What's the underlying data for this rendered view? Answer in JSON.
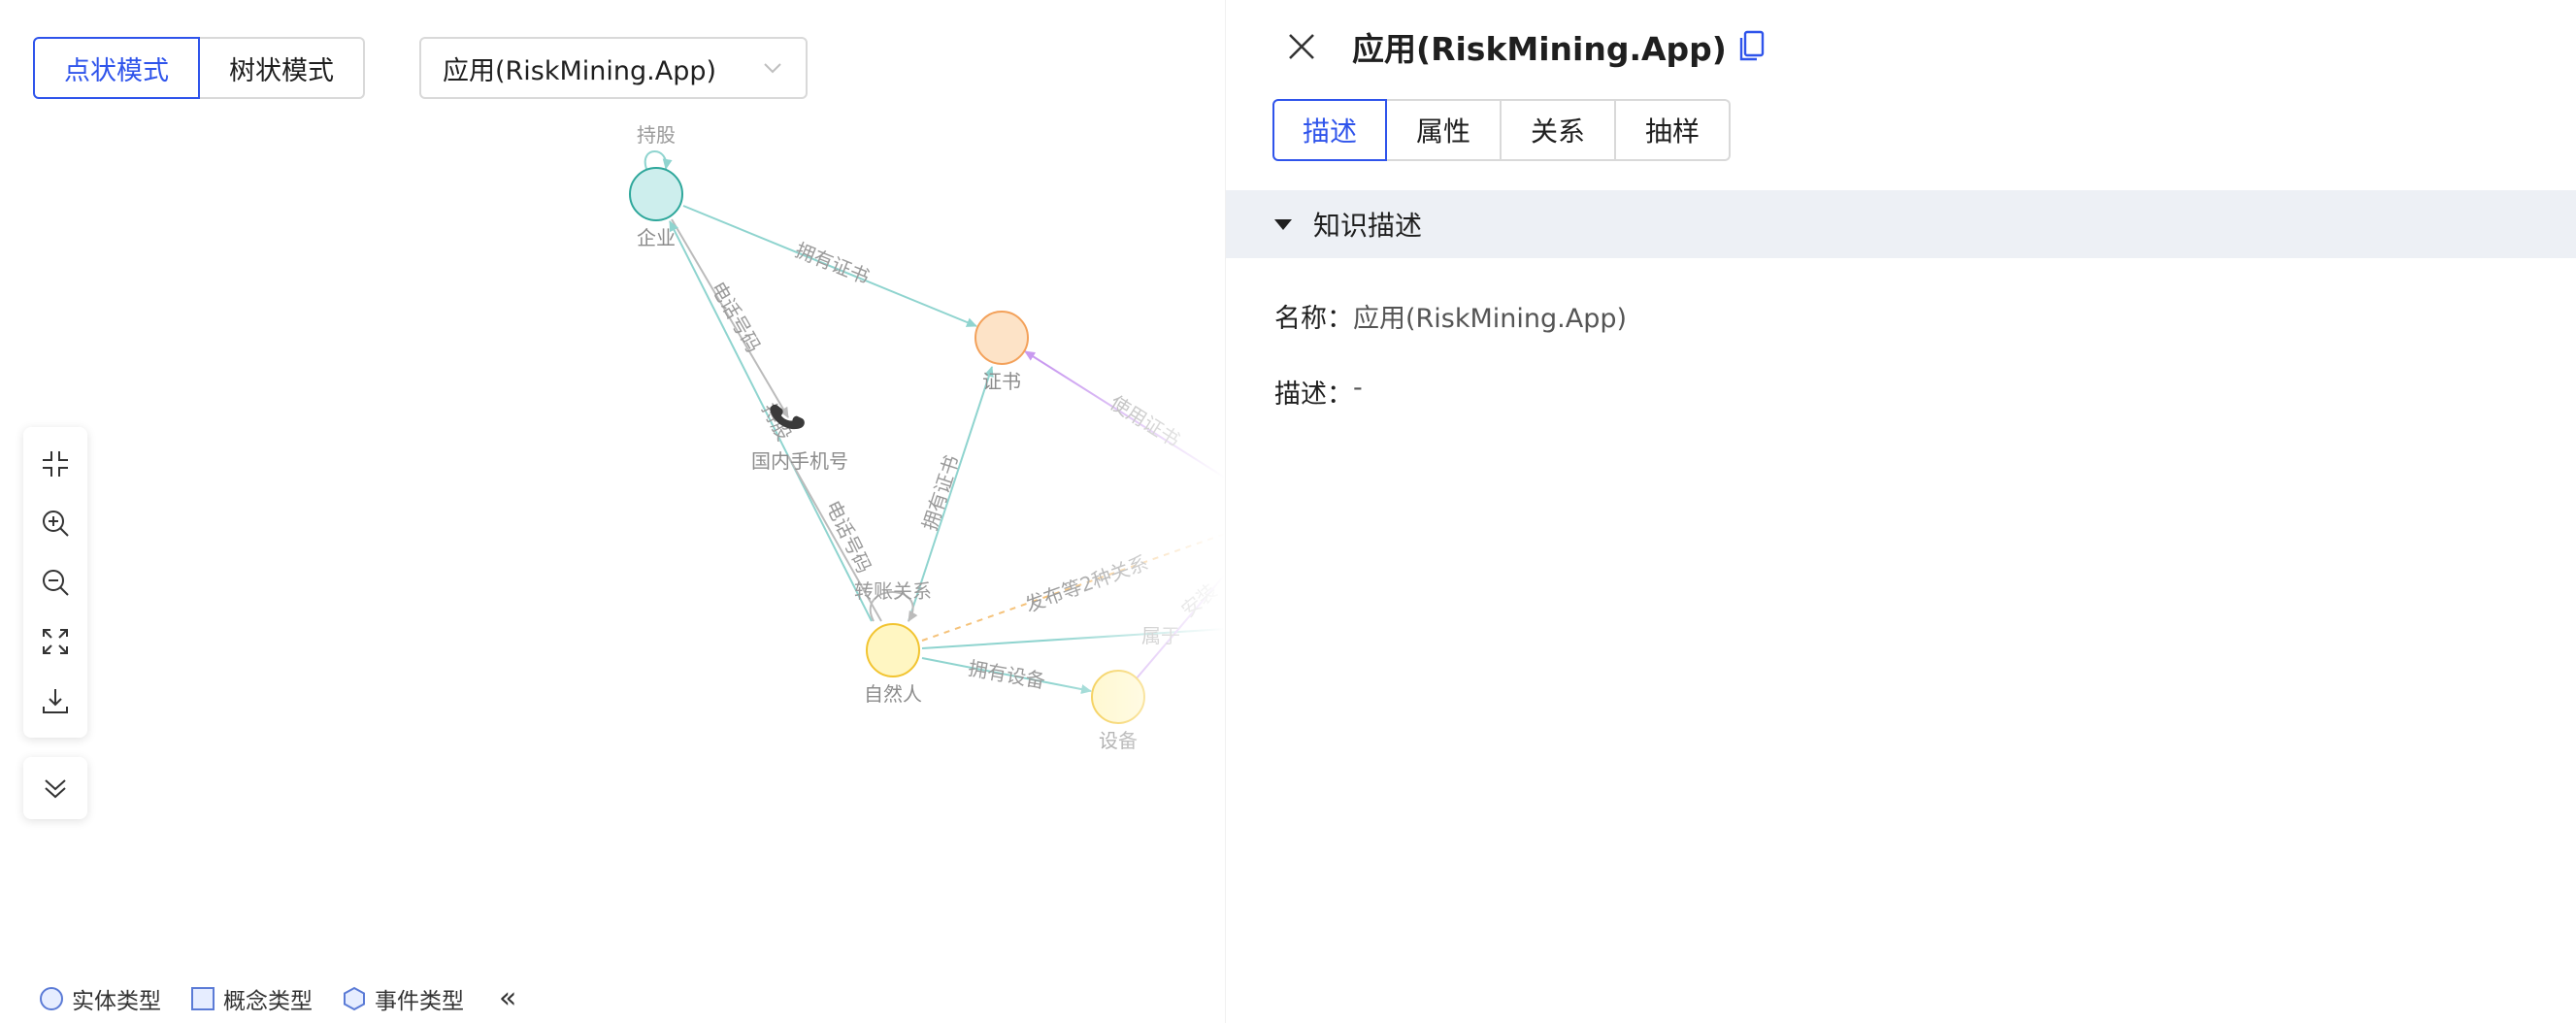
{
  "toolbar": {
    "modes": [
      "点状模式",
      "树状模式"
    ],
    "active_mode": "点状模式",
    "type_select_value": "应用(RiskMining.App)"
  },
  "graph": {
    "nodes": [
      {
        "id": "enterprise",
        "label": "企业",
        "fill": "#cdeeed",
        "stroke": "#2ea79b"
      },
      {
        "id": "cert",
        "label": "证书",
        "fill": "#fde3c7",
        "stroke": "#f3a15a"
      },
      {
        "id": "phone",
        "label": "国内手机号",
        "icon": "phone-icon"
      },
      {
        "id": "person",
        "label": "自然人",
        "fill": "#fff6c2",
        "stroke": "#f2c430"
      },
      {
        "id": "device",
        "label": "设备",
        "fill": "#fff6c2",
        "stroke": "#f2c430"
      }
    ],
    "edges": [
      {
        "label": "持股"
      },
      {
        "label": "拥有证书"
      },
      {
        "label": "电话号码"
      },
      {
        "label": "持股"
      },
      {
        "label": "电话号码"
      },
      {
        "label": "拥有证书"
      },
      {
        "label": "使用证书"
      },
      {
        "label": "转账关系"
      },
      {
        "label": "发布等2种关系"
      },
      {
        "label": "拥有设备"
      },
      {
        "label": "属于"
      },
      {
        "label": "安装"
      }
    ]
  },
  "legend": {
    "items": [
      "实体类型",
      "概念类型",
      "事件类型"
    ],
    "toggle": "«"
  },
  "panel": {
    "title": "应用(RiskMining.App)",
    "tabs": [
      "描述",
      "属性",
      "关系",
      "抽样"
    ],
    "active_tab": "描述",
    "section_title": "知识描述",
    "fields": [
      {
        "label": "名称：",
        "value": "应用(RiskMining.App)"
      },
      {
        "label": "描述：",
        "value": "-"
      }
    ]
  },
  "colors": {
    "accent": "#2f54eb",
    "edge_teal": "#7ecfca",
    "edge_purple": "#c99af0",
    "edge_orange_dashed": "#f5c27a"
  }
}
